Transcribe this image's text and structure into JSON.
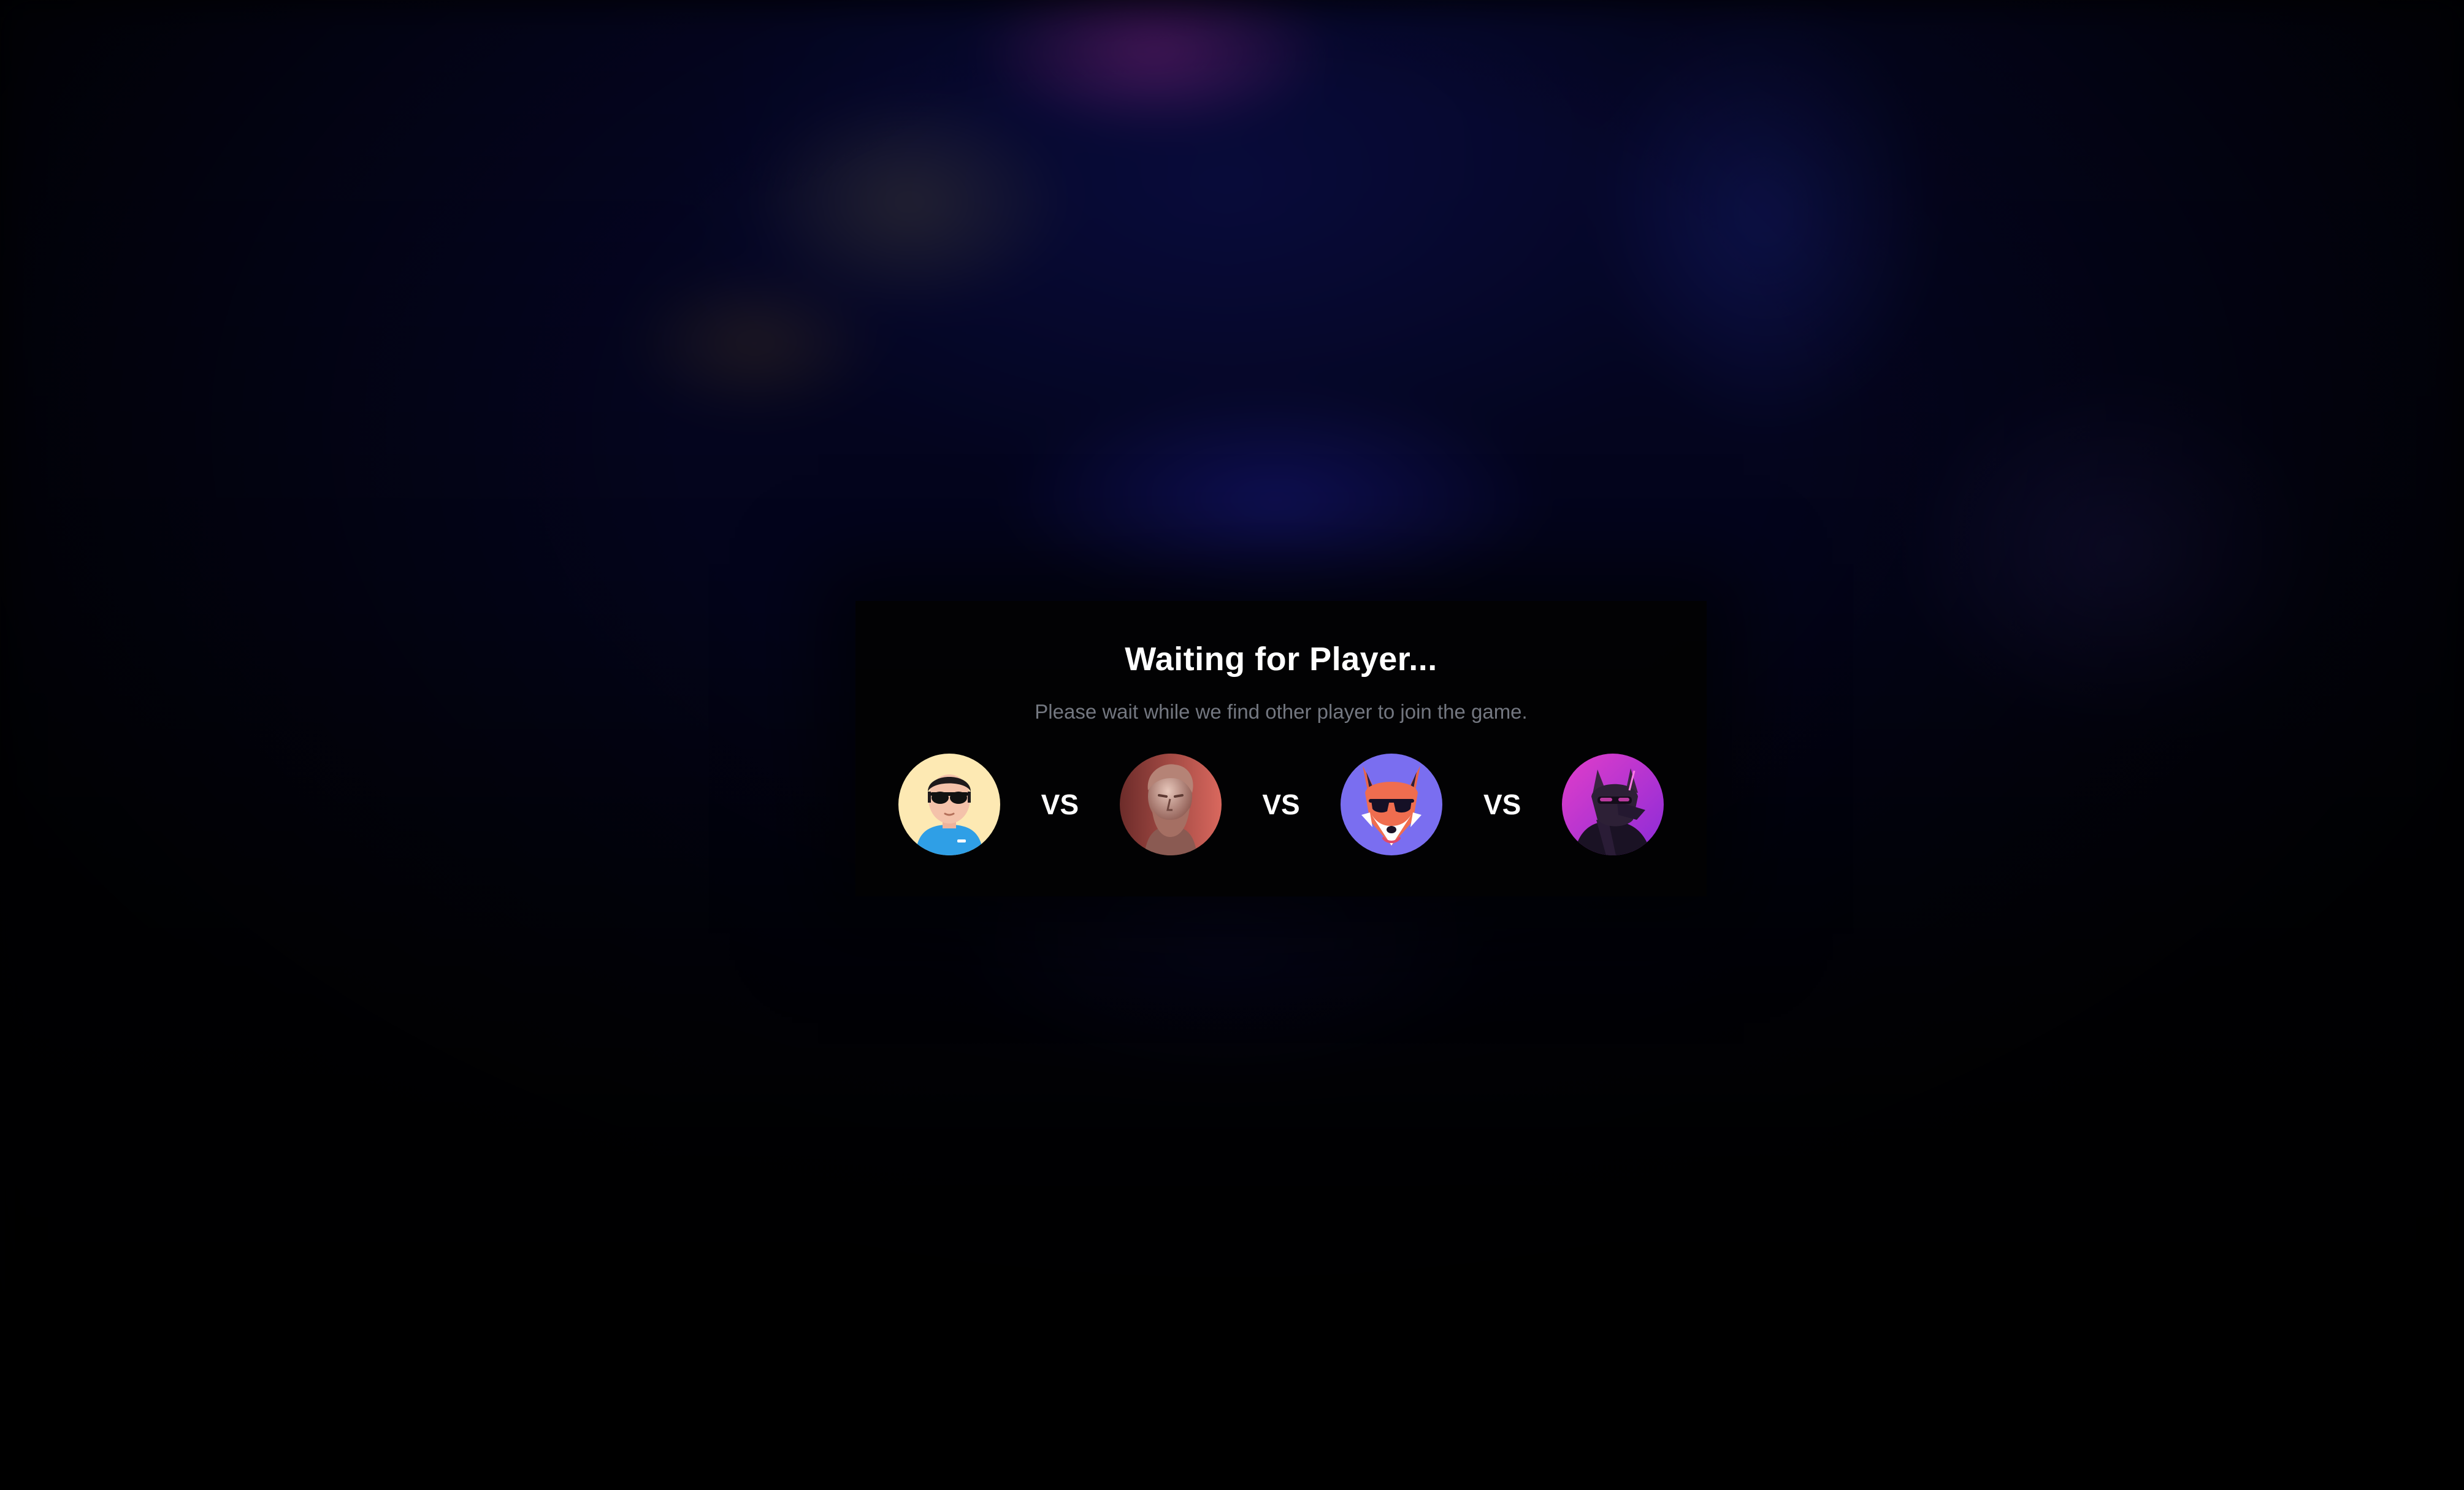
{
  "modal": {
    "title": "Waiting for Player...",
    "subtitle": "Please wait while we find other player to join the game."
  },
  "players": [
    {
      "avatar": "cool-guy-sunglasses-avatar",
      "bg_color": "#fde9b3"
    },
    {
      "avatar": "greek-statue-avatar",
      "bg_color": "#c9615a"
    },
    {
      "avatar": "fox-sunglasses-avatar",
      "bg_color": "#7a6ef0"
    },
    {
      "avatar": "cyber-wolf-avatar",
      "bg_color": "#c23ad4"
    }
  ],
  "vs_labels": [
    "VS",
    "VS",
    "VS"
  ]
}
